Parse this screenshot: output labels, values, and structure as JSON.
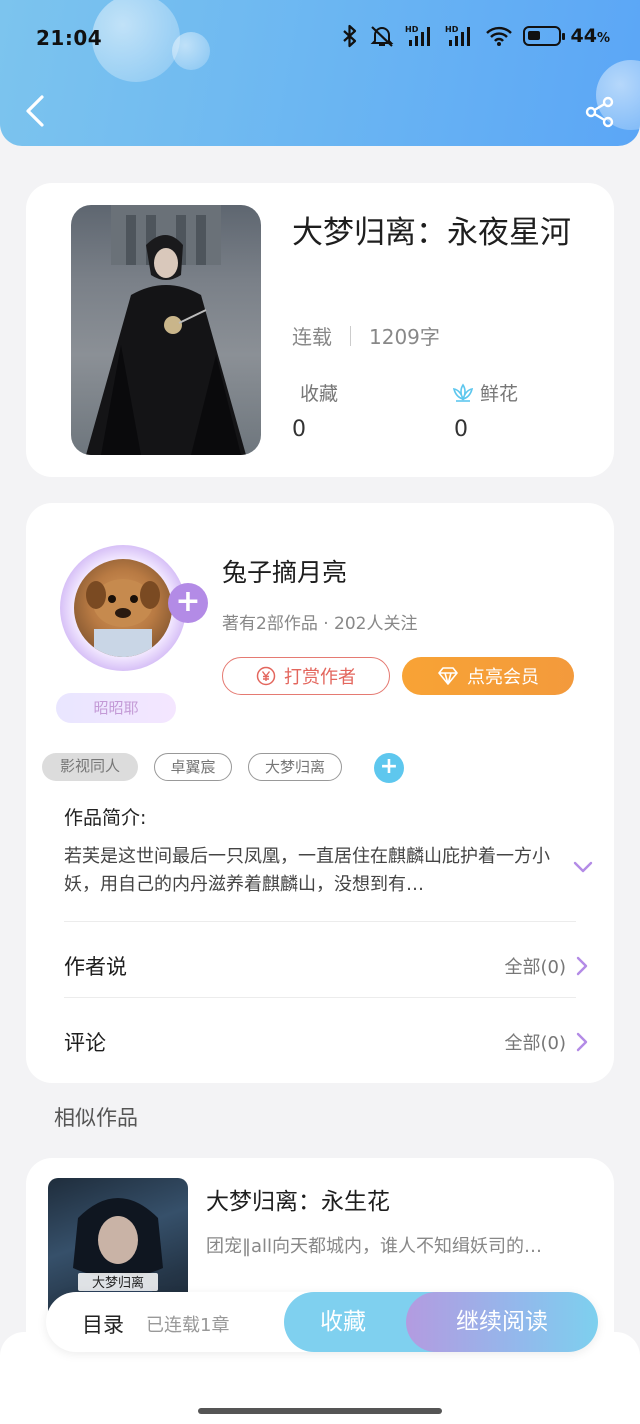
{
  "status_bar": {
    "time": "21:04",
    "battery_pct": "44",
    "battery_unit": "%",
    "icons": [
      "bluetooth-icon",
      "mute-icon",
      "hd-signal-icon",
      "hd-signal-icon",
      "wifi-icon",
      "battery-icon"
    ]
  },
  "header": {
    "back_icon": "chevron-left-icon",
    "share_icon": "share-icon"
  },
  "book": {
    "title": "大梦归离：永夜星河",
    "status": "连载",
    "word_count": "1209字",
    "favorites_label": "收藏",
    "favorites_count": "0",
    "flowers_label": "鲜花",
    "flowers_count": "0"
  },
  "author": {
    "name": "兔子摘月亮",
    "meta": "著有2部作品 · 202人关注",
    "badge": "昭昭耶",
    "follow_symbol": "+",
    "tip_label": "打赏作者",
    "vip_label": "点亮会员"
  },
  "tags": [
    "影视同人",
    "卓翼宸",
    "大梦归离"
  ],
  "tag_add_symbol": "+",
  "intro": {
    "title": "作品简介:",
    "text": "若芙是这世间最后一只凤凰，一直居住在麒麟山庇护着一方小妖，用自己的内丹滋养着麒麟山，没想到有…"
  },
  "rows": {
    "author_says_label": "作者说",
    "author_says_value": "全部(0)",
    "comments_label": "评论",
    "comments_value": "全部(0)"
  },
  "similar": {
    "section_title": "相似作品",
    "items": [
      {
        "title": "大梦归离：永生花",
        "desc": "团宠‖all向天都城内，谁人不知缉妖司的…",
        "cover_text": "大梦归离"
      }
    ]
  },
  "bottom_bar": {
    "toc_label": "目录",
    "chapters_label": "已连载1章",
    "collect_label": "收藏",
    "read_label": "继续阅读"
  },
  "colors": {
    "header_gradient_start": "#7cc4ee",
    "header_gradient_end": "#5ba6f6",
    "tip_red": "#e3665d",
    "vip_orange": "#f8a335",
    "accent_purple": "#b38be6",
    "accent_cyan": "#5ec7ee"
  }
}
